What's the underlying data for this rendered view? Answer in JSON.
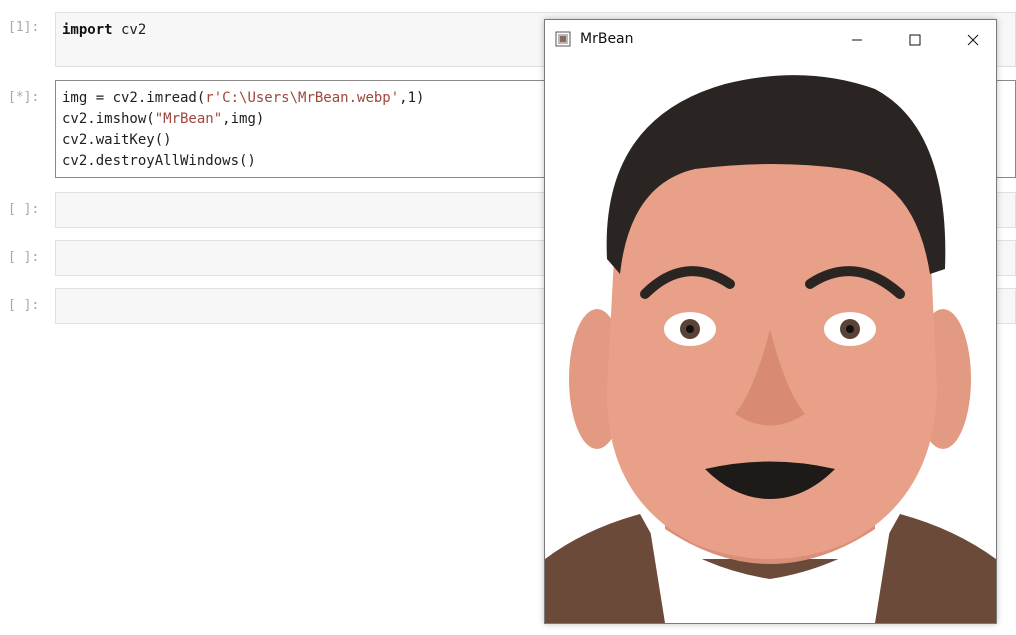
{
  "notebook": {
    "cells": [
      {
        "prompt": "[1]:",
        "code_lines": [
          {
            "kw": "import",
            "rest": " cv2"
          }
        ]
      },
      {
        "prompt": "[*]:",
        "line1_a": "img = cv2.imread(",
        "line1_str": "r'C:\\Users\\MrBean.webp'",
        "line1_b": ",1)",
        "line2_a": "cv2.imshow(",
        "line2_str": "\"MrBean\"",
        "line2_b": ",img)",
        "line3": "cv2.waitKey()",
        "line4": "cv2.destroyAllWindows()"
      },
      {
        "prompt": "[ ]:"
      },
      {
        "prompt": "[ ]:"
      },
      {
        "prompt": "[ ]:"
      }
    ]
  },
  "window": {
    "title": "MrBean",
    "icons": [
      "app-icon",
      "minimize-icon",
      "maximize-icon",
      "close-icon"
    ],
    "image_subject": "face-photo"
  },
  "colors": {
    "skin": "#e9a088",
    "hair": "#2a2522",
    "jacket": "#6b4a3a",
    "shirt": "#ffffff"
  }
}
